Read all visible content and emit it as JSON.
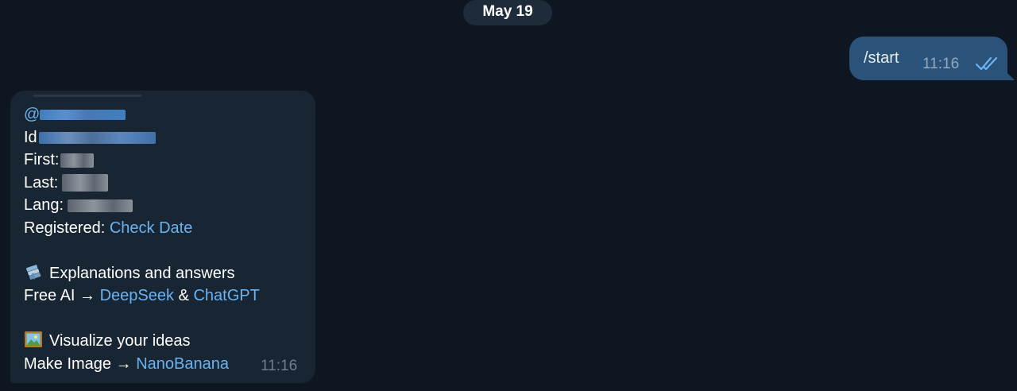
{
  "date_label": "May 19",
  "outgoing": {
    "text": "/start",
    "time": "11:16",
    "status_icon": "double-check-icon"
  },
  "incoming": {
    "username_prefix": "@",
    "id_label": "Id",
    "first_label": "First:",
    "last_label": "Last:",
    "lang_label": "Lang:",
    "registered_label": "Registered:",
    "registered_link": "Check Date",
    "section1_icon": "books-icon",
    "section1_title": "Explanations and answers",
    "free_ai_label": "Free AI",
    "arrow": "→",
    "deepseek_link": "DeepSeek",
    "ampersand": "&",
    "chatgpt_link": "ChatGPT",
    "section2_icon": "framed-picture-icon",
    "section2_title": "Visualize your ideas",
    "make_image_label": "Make Image",
    "nanobanana_link": "NanoBanana",
    "time": "11:16"
  },
  "colors": {
    "background": "#0e1621",
    "incoming_bubble": "#182533",
    "outgoing_bubble": "#2b5278",
    "link": "#6ab3f3",
    "date_pill": "#1e2c3a"
  }
}
